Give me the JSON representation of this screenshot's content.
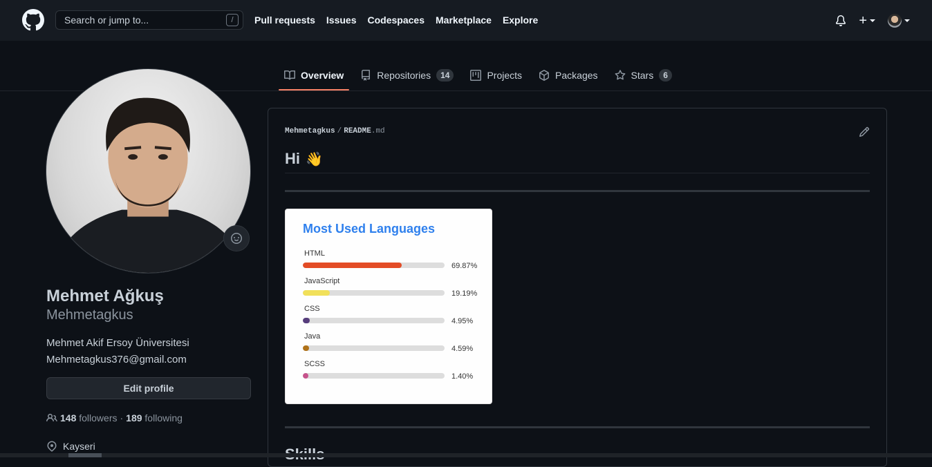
{
  "header": {
    "search_placeholder": "Search or jump to...",
    "search_shortcut": "/",
    "nav": [
      "Pull requests",
      "Issues",
      "Codespaces",
      "Marketplace",
      "Explore"
    ],
    "create_label": "+"
  },
  "tabs": [
    {
      "label": "Overview",
      "icon": "book-icon",
      "active": true
    },
    {
      "label": "Repositories",
      "icon": "repo-icon",
      "count": "14"
    },
    {
      "label": "Projects",
      "icon": "project-icon"
    },
    {
      "label": "Packages",
      "icon": "package-icon"
    },
    {
      "label": "Stars",
      "icon": "star-icon",
      "count": "6"
    }
  ],
  "profile": {
    "fullname": "Mehmet Ağkuş",
    "username": "Mehmetagkus",
    "bio_line1": "Mehmet Akif Ersoy Üniversitesi",
    "bio_line2": "Mehmetagkus376@gmail.com",
    "edit_button": "Edit profile",
    "followers_count": "148",
    "followers_label": "followers",
    "dot": "·",
    "following_count": "189",
    "following_label": "following",
    "location": "Kayseri"
  },
  "readme": {
    "owner": "Mehmetagkus",
    "separator": "/",
    "file_name": "README",
    "file_ext": ".md",
    "greeting": "Hi",
    "greeting_emoji": "👋",
    "next_heading": "Skills"
  },
  "languages_card": {
    "title": "Most Used Languages",
    "title_color": "#2f80ed",
    "items": [
      {
        "name": "HTML",
        "percent": "69.87%",
        "fraction": 0.6987,
        "color": "#e34c26"
      },
      {
        "name": "JavaScript",
        "percent": "19.19%",
        "fraction": 0.1919,
        "color": "#f1e05a"
      },
      {
        "name": "CSS",
        "percent": "4.95%",
        "fraction": 0.0495,
        "color": "#563d7c"
      },
      {
        "name": "Java",
        "percent": "4.59%",
        "fraction": 0.0459,
        "color": "#b07219"
      },
      {
        "name": "SCSS",
        "percent": "1.40%",
        "fraction": 0.014,
        "color": "#c6538c"
      }
    ]
  },
  "colors": {
    "background": "#0d1117",
    "header": "#161b22",
    "active_tab_underline": "#f78166"
  }
}
